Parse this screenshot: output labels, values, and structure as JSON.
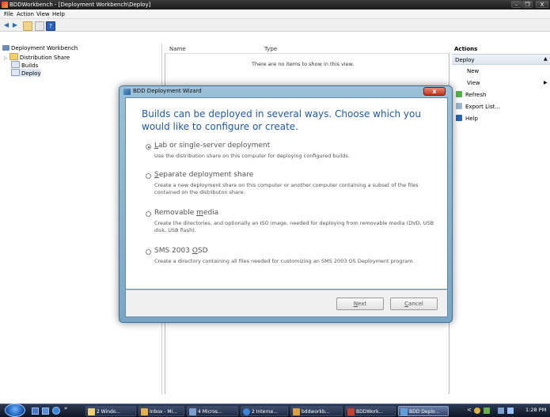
{
  "window": {
    "title": "BDDWorkbench - [Deployment Workbench\\Deploy]",
    "controls": {
      "minimize": "–",
      "maximize": "❐",
      "close": "X"
    }
  },
  "menu": [
    "File",
    "Action",
    "View",
    "Help"
  ],
  "tree": {
    "root": "Deployment Workbench",
    "items": [
      "Distribution Share",
      "Builds",
      "Deploy"
    ]
  },
  "list": {
    "columns": [
      "Name",
      "Type"
    ],
    "empty_message": "There are no items to show in this view."
  },
  "actions": {
    "header": "Actions",
    "section": "Deploy",
    "items": [
      "New",
      "View",
      "Refresh",
      "Export List...",
      "Help"
    ]
  },
  "dialog": {
    "title": "BDD Deployment Wizard",
    "heading": "Builds can be deployed in several ways. Choose which you would like to configure or create.",
    "options": [
      {
        "title_pre": "",
        "title_key": "L",
        "title_post": "ab or single-server deployment",
        "desc": "Use the distribution share on this computer for deploying configured builds.",
        "selected": true
      },
      {
        "title_pre": "",
        "title_key": "S",
        "title_post": "eparate deployment share",
        "desc": "Create a new deployment share on this computer or another computer containing a subset of the files contained on the distributon share.",
        "selected": false
      },
      {
        "title_pre": "Removable ",
        "title_key": "m",
        "title_post": "edia",
        "desc": "Create the directories, and optionally an ISO image, needed for deploying from removable media (DVD, USB disk, USB flash).",
        "selected": false
      },
      {
        "title_pre": "SMS 2003 ",
        "title_key": "O",
        "title_post": "SD",
        "desc": "Create a directory containing all files needed for customizing an SMS 2003 OS Deployment program.",
        "selected": false
      }
    ],
    "buttons": {
      "next_key": "N",
      "next_rest": "ext",
      "cancel_key": "C",
      "cancel_rest": "ancel"
    },
    "close_label": "x"
  },
  "taskbar": {
    "quick_launch_more": "»",
    "items": [
      "2 Windo...",
      "Inbox - Mi...",
      "4 Micros...",
      "2 Interne...",
      "bddworkb...",
      "BDDWork...",
      "BDD Deplo..."
    ],
    "clock": "1:28 PM",
    "tray_more": "<"
  },
  "colors": {
    "heading": "#1f5aa8",
    "titlebar": "#1a1a1a",
    "dialog_frame": "#7aa6c4"
  }
}
